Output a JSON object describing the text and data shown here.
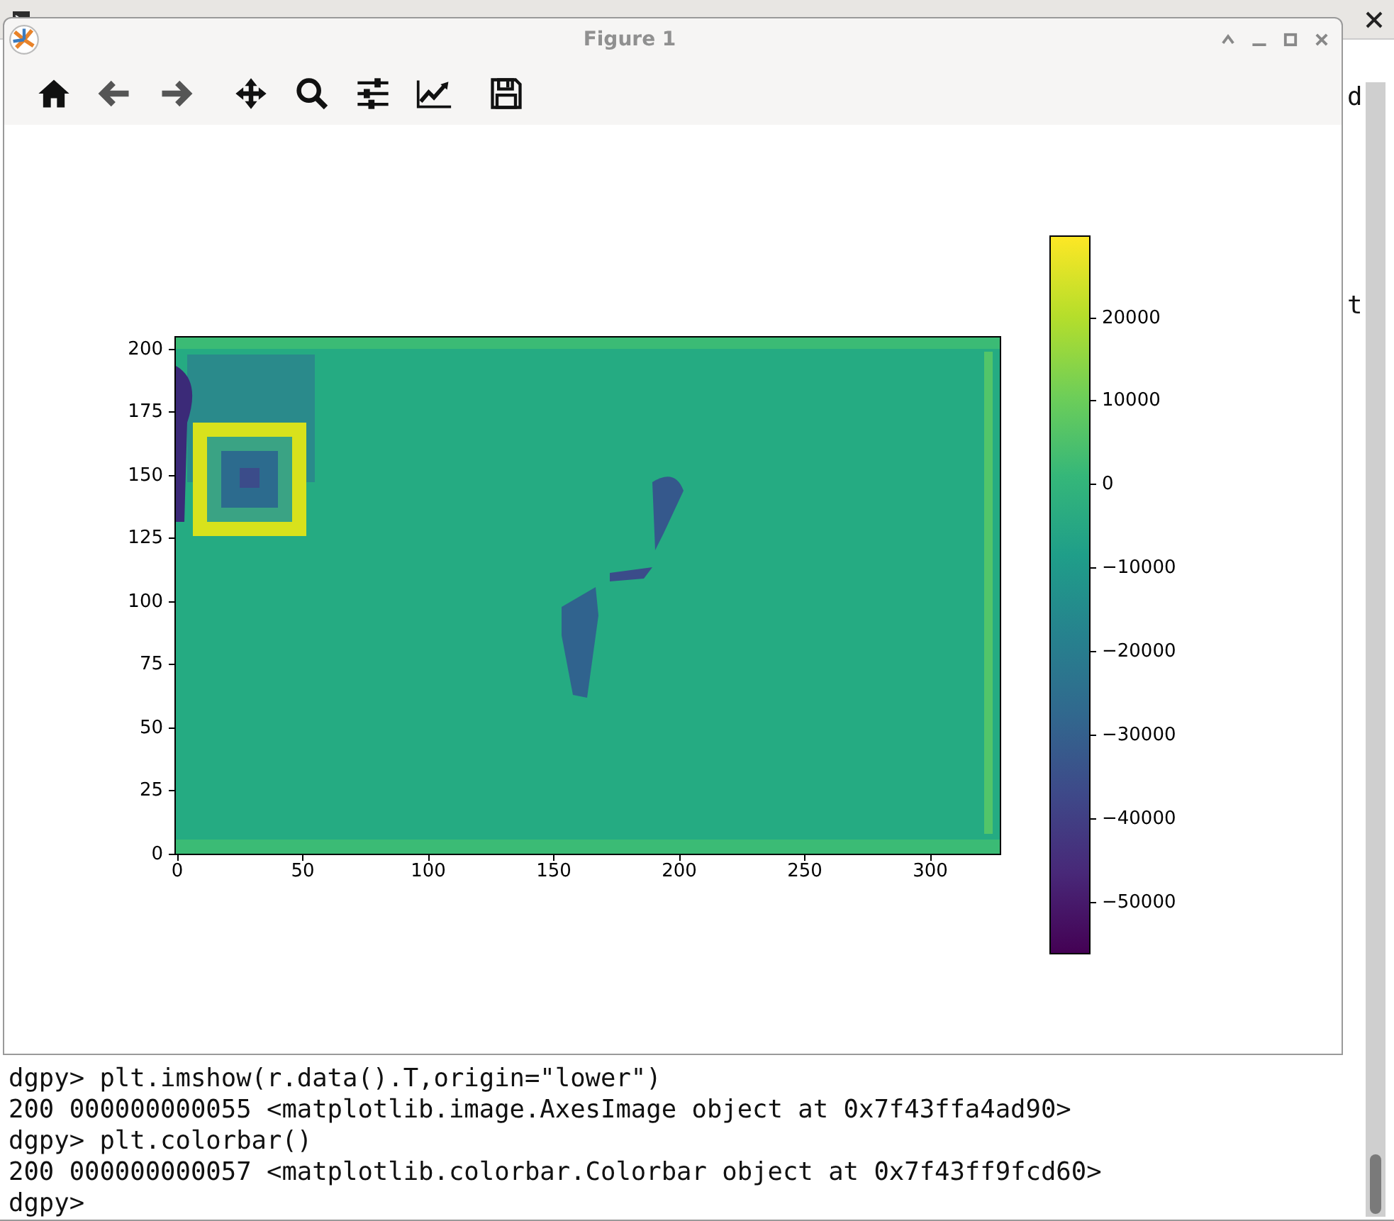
{
  "terminal": {
    "fragments": [
      "d",
      "t"
    ],
    "lines": [
      "dgpy> plt.imshow(r.data().T,origin=\"lower\")",
      "200 000000000055 <matplotlib.image.AxesImage object at 0x7f43ffa4ad90>",
      "dgpy> plt.colorbar()",
      "200 000000000057 <matplotlib.colorbar.Colorbar object at 0x7f43ff9fcd60>",
      "dgpy>"
    ]
  },
  "figure": {
    "title": "Figure 1",
    "toolbar": [
      {
        "kind": "home"
      },
      {
        "kind": "back"
      },
      {
        "kind": "forward"
      },
      {
        "kind": "pan"
      },
      {
        "kind": "zoom"
      },
      {
        "kind": "configure"
      },
      {
        "kind": "edit"
      },
      {
        "kind": "save"
      }
    ],
    "axes": {
      "image": {
        "kind": "picture"
      },
      "xticks": [
        "0",
        "50",
        "100",
        "150",
        "200",
        "250",
        "300"
      ],
      "yticks": [
        "200",
        "175",
        "150",
        "125",
        "100",
        "75",
        "50",
        "25",
        "0"
      ]
    },
    "colorbar": {
      "ticks": [
        "20000",
        "10000",
        "0",
        "−10000",
        "−20000",
        "−30000",
        "−40000",
        "−50000"
      ]
    }
  }
}
